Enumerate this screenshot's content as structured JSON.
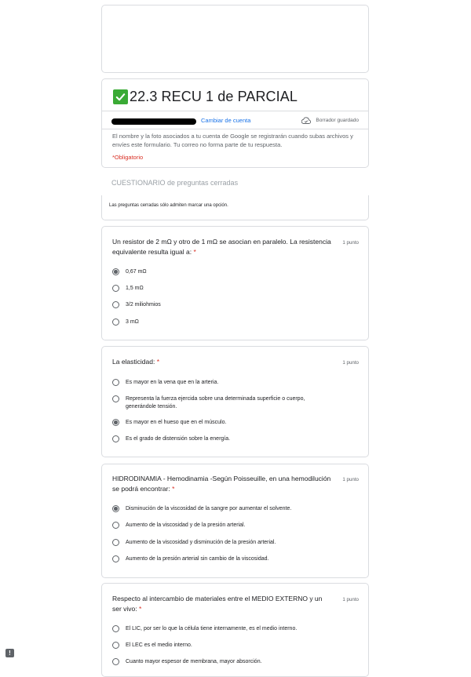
{
  "form": {
    "title": "22.3 RECU 1 de PARCIAL",
    "switch_account": "Cambiar de cuenta",
    "draft_status": "Borrador guardado",
    "notice": "El nombre y la foto asociados a tu cuenta de Google se registrarán cuando subas archivos y envíes este formulario. Tu correo no forma parte de tu respuesta.",
    "required_note": "*Obligatorio"
  },
  "section": {
    "title": "CUESTIONARIO de preguntas cerradas",
    "description": "Las preguntas cerradas sólo admiten marcar una opción."
  },
  "questions": [
    {
      "text": "Un resistor de 2 mΩ y otro de 1 mΩ se asocian en paralelo. La resistencia equivalente resulta igual a:",
      "required_mark": "*",
      "points": "1 punto",
      "selected_index": 0,
      "options": [
        "0,67 mΩ",
        "1,5 mΩ",
        "3/2 miliohmios",
        "3 mΩ"
      ]
    },
    {
      "text": "La elasticidad:",
      "required_mark": "*",
      "points": "1 punto",
      "selected_index": 2,
      "options": [
        "Es mayor en la vena que en la arteria.",
        "Representa la fuerza ejercida sobre una determinada superficie o cuerpo, generándole tensión.",
        "Es mayor en el hueso que en el músculo.",
        "Es el grado de distensión sobre la energía."
      ]
    },
    {
      "text": "HIDRODINAMIA - Hemodinamia -Según Poisseuille, en una hemodilución se podrá encontrar:",
      "required_mark": "*",
      "points": "1 punto",
      "selected_index": 0,
      "options": [
        "Disminución de la viscosidad de la sangre por aumentar el solvente.",
        "Aumento de la viscosidad y de la presión arterial.",
        "Aumento de la viscosidad y disminución de la presión arterial.",
        "Aumento de la presión arterial sin cambio de la viscosidad."
      ]
    },
    {
      "text": "Respecto al intercambio de materiales entre el MEDIO EXTERNO y un ser vivo:",
      "required_mark": "*",
      "points": "1 punto",
      "selected_index": -1,
      "options": [
        "El LIC, por ser lo que la célula tiene internamente, es el medio interno.",
        "El LEC es el medio interno.",
        "Cuanto mayor espesor de membrana, mayor absorción."
      ]
    }
  ],
  "feedback_label": "!",
  "colors": {
    "accent": "#1a73e8",
    "required": "#d93025",
    "check": "#3aaa35"
  }
}
